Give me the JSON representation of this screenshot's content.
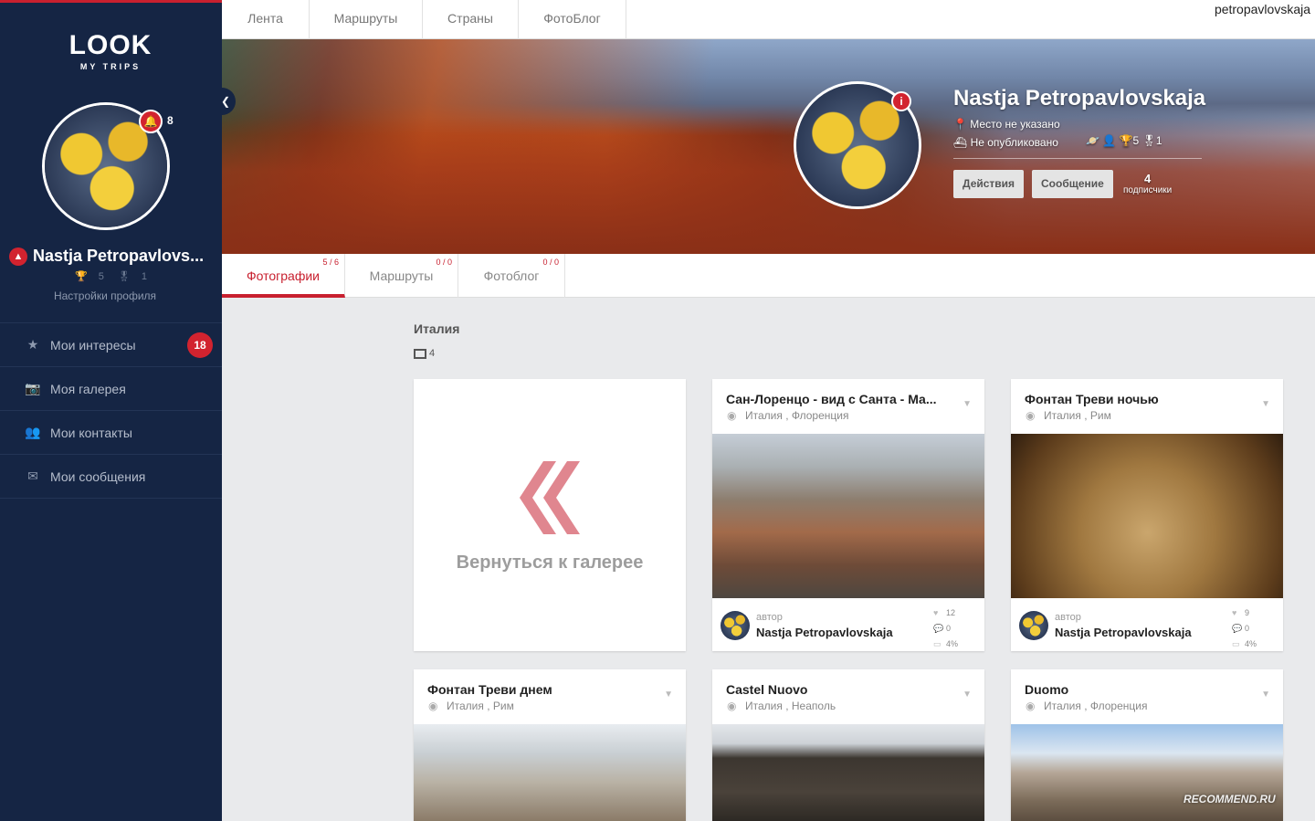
{
  "app": {
    "logo_top": "LOOK",
    "logo_bottom": "MY TRIPS"
  },
  "sidebar": {
    "notifications_count": "8",
    "user_name": "Nastja Petropavlovs...",
    "trophies": "5",
    "medals": "1",
    "settings_label": "Настройки профиля",
    "menu": [
      {
        "label": "Мои интересы",
        "icon": "star-icon",
        "badge": "18"
      },
      {
        "label": "Моя галерея",
        "icon": "camera-icon"
      },
      {
        "label": "Мои контакты",
        "icon": "contacts-icon"
      },
      {
        "label": "Мои сообщения",
        "icon": "envelope-icon"
      }
    ]
  },
  "topnav": {
    "tabs": [
      "Лента",
      "Маршруты",
      "Страны",
      "ФотоБлог"
    ],
    "username": "petropavlovskaja"
  },
  "profile": {
    "name": "Nastja Petropavlovskaja",
    "location": "Место не указано",
    "published": "Не опубликовано",
    "trophies": "5",
    "medals": "1",
    "actions_label": "Действия",
    "message_label": "Сообщение",
    "subscribers_count": "4",
    "subscribers_label": "подписчики"
  },
  "content_tabs": [
    {
      "label": "Фотографии",
      "count": "5 / 6",
      "active": true
    },
    {
      "label": "Маршруты",
      "count": "0 / 0"
    },
    {
      "label": "Фотоблог",
      "count": "0 / 0"
    }
  ],
  "gallery": {
    "title": "Италия",
    "photo_count": "4",
    "back_label": "Вернуться к галерее",
    "author_label": "автор",
    "author_name": "Nastja Petropavlovskaja",
    "cards": [
      {
        "title": "Сан-Лоренцо - вид с Санта - Ма...",
        "country": "Италия",
        "city": "Флоренция",
        "likes": "12",
        "comments": "0",
        "percent": "4%"
      },
      {
        "title": "Фонтан Треви ночью",
        "country": "Италия",
        "city": "Рим",
        "likes": "9",
        "comments": "0",
        "percent": "4%"
      },
      {
        "title": "Фонтан Треви днем",
        "country": "Италия",
        "city": "Рим"
      },
      {
        "title": "Castel Nuovo",
        "country": "Италия",
        "city": "Неаполь"
      },
      {
        "title": "Duomo",
        "country": "Италия",
        "city": "Флоренция"
      }
    ]
  },
  "watermark": "RECOMMEND.RU",
  "colors": {
    "sidebar_bg": "#152544",
    "accent": "#c8202f",
    "page_bg": "#e9eaec"
  }
}
